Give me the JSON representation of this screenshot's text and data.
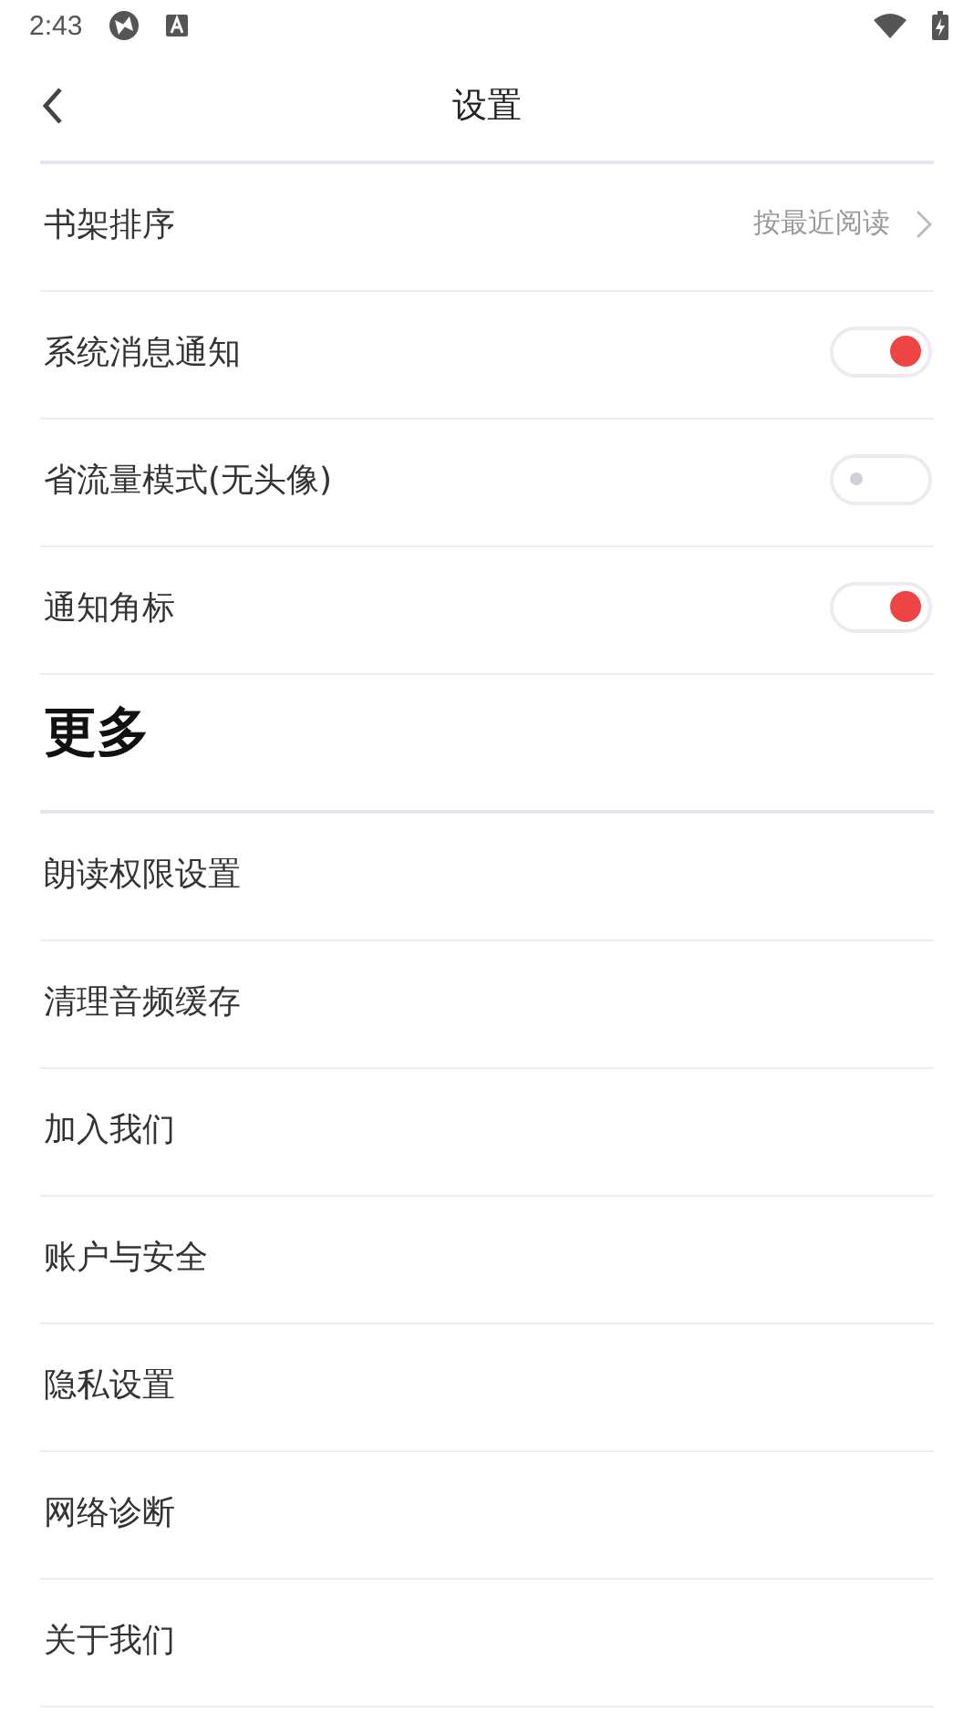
{
  "status_bar": {
    "time": "2:43"
  },
  "header": {
    "title": "设置"
  },
  "settings": [
    {
      "kind": "link",
      "label": "书架排序",
      "value": "按最近阅读"
    },
    {
      "kind": "toggle",
      "label": "系统消息通知",
      "on": true
    },
    {
      "kind": "toggle",
      "label": "省流量模式(无头像)",
      "on": false
    },
    {
      "kind": "toggle",
      "label": "通知角标",
      "on": true
    }
  ],
  "more": {
    "heading": "更多",
    "items": [
      "朗读权限设置",
      "清理音频缓存",
      "加入我们",
      "账户与安全",
      "隐私设置",
      "网络诊断",
      "关于我们"
    ]
  }
}
